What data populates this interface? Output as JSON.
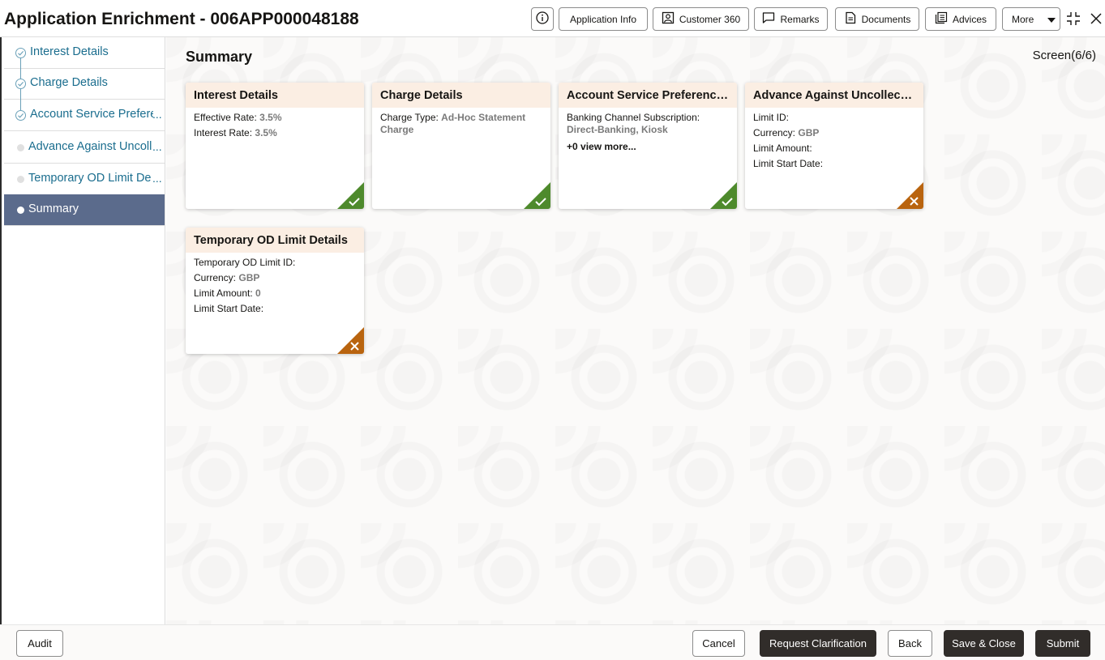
{
  "header": {
    "title": "Application Enrichment - 006APP000048188",
    "buttons": {
      "info_icon": "info-icon",
      "application_info": "Application Info",
      "customer_360": "Customer 360",
      "remarks": "Remarks",
      "documents": "Documents",
      "advices": "Advices",
      "more": "More"
    }
  },
  "sidebar": {
    "items": [
      {
        "label": "Interest Details",
        "status": "done",
        "truncated": false
      },
      {
        "label": "Charge Details",
        "status": "done",
        "truncated": false
      },
      {
        "label": "Account Service Prefere",
        "status": "done",
        "truncated": true
      },
      {
        "label": "Advance Against Uncoll",
        "status": "todo",
        "truncated": true
      },
      {
        "label": "Temporary OD Limit De",
        "status": "todo",
        "truncated": true
      },
      {
        "label": "Summary",
        "status": "active",
        "truncated": false
      }
    ],
    "ellipsis": "..."
  },
  "main": {
    "title": "Summary",
    "screen_indicator": "Screen(6/6)",
    "cards": [
      {
        "title": "Interest Details",
        "rows": [
          {
            "label": "Effective Rate:",
            "value": "3.5%"
          },
          {
            "label": "Interest Rate:",
            "value": "3.5%"
          }
        ],
        "status": "complete"
      },
      {
        "title": "Charge Details",
        "rows": [
          {
            "label": "Charge Type:",
            "value": "Ad-Hoc Statement Charge"
          }
        ],
        "status": "complete"
      },
      {
        "title": "Account Service Preferences",
        "rows": [
          {
            "label": "Banking Channel Subscription:",
            "value": "Direct-Banking, Kiosk"
          }
        ],
        "view_more": "+0 view more...",
        "status": "complete"
      },
      {
        "title": "Advance Against Uncollecte...",
        "rows": [
          {
            "label": "Limit ID:",
            "value": ""
          },
          {
            "label": "Currency:",
            "value": "GBP"
          },
          {
            "label": "Limit Amount:",
            "value": ""
          },
          {
            "label": "Limit Start Date:",
            "value": ""
          }
        ],
        "status": "incomplete"
      },
      {
        "title": "Temporary OD Limit Details",
        "rows": [
          {
            "label": "Temporary OD Limit ID:",
            "value": ""
          },
          {
            "label": "Currency:",
            "value": "GBP"
          },
          {
            "label": "Limit Amount:",
            "value": "0"
          },
          {
            "label": "Limit Start Date:",
            "value": ""
          }
        ],
        "status": "incomplete"
      }
    ]
  },
  "footer": {
    "audit": "Audit",
    "cancel": "Cancel",
    "request_clarification": "Request Clarification",
    "back": "Back",
    "save_close": "Save & Close",
    "submit": "Submit"
  },
  "colors": {
    "complete": "#4e8a2c",
    "incomplete": "#b9640f",
    "card_header": "#fbeee3",
    "sidebar_active": "#5b6b8c",
    "link": "#1a6d8e",
    "solid_button": "#312d2a"
  }
}
